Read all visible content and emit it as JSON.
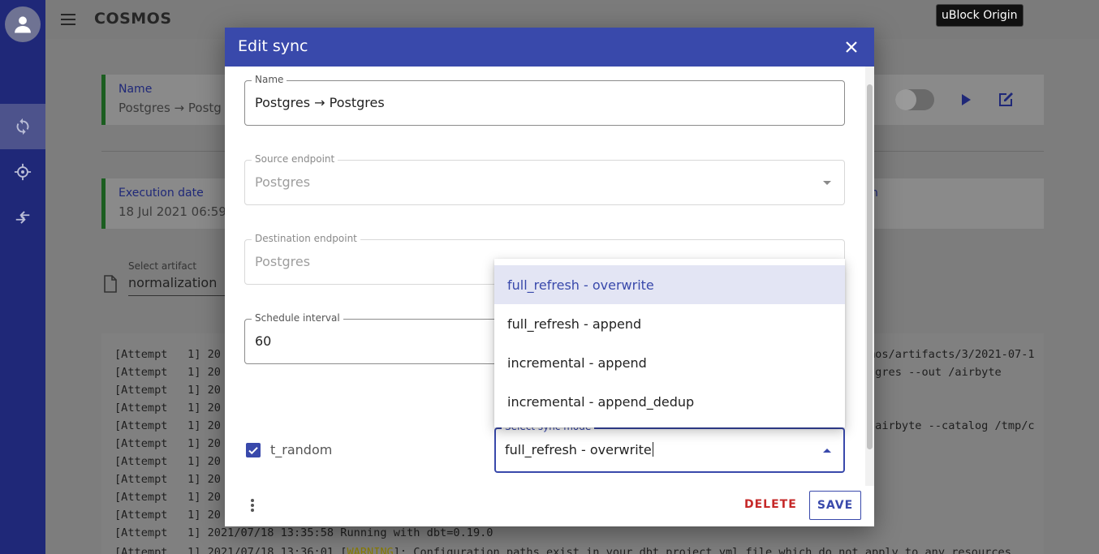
{
  "app": {
    "name": "COSMOS"
  },
  "tooltip": {
    "text": "uBlock Origin"
  },
  "background": {
    "name_card": {
      "label": "Name",
      "value": "Postgres → Postg"
    },
    "execution_card": {
      "label": "Execution date",
      "value": "18 Jul 2021 06:59"
    },
    "right_card_label": "n",
    "artifact": {
      "label": "Select artifact",
      "value": "normalization"
    },
    "log": {
      "lines": [
        {
          "prefix": "[Attempt   1] 20",
          "suffix": "mos/artifacts/3/2021-07-1"
        },
        {
          "prefix": "[Attempt   1] 20",
          "suffix": "tgres --out /airbyte"
        },
        {
          "prefix": "[Attempt   1] 20",
          "suffix": ""
        },
        {
          "prefix": "[Attempt   1] 20",
          "suffix": ""
        },
        {
          "prefix": "[Attempt   1] 20",
          "suffix": "/airbyte --catalog /tmp/c"
        },
        {
          "prefix": "[Attempt   1] 20",
          "suffix": ""
        },
        {
          "prefix": "[Attempt   1] 20",
          "suffix": ""
        },
        {
          "prefix": "[Attempt   1] 20",
          "suffix": ""
        },
        {
          "prefix": "[Attempt   1] 20",
          "suffix": ""
        },
        {
          "prefix": "[Attempt   1] 20",
          "suffix": ""
        },
        {
          "prefix": "[Attempt   1] 2021/07/18 13:35:58 Running with dbt=0.19.0",
          "suffix": ""
        }
      ],
      "last_line": {
        "before": "[Attempt   1] 2021/07/18 13:36:01 [",
        "warn": "WARNING",
        "after": "]: Configuration paths exist in your dbt_project.yml file which do not apply to any resources"
      }
    }
  },
  "dialog": {
    "title": "Edit sync",
    "fields": {
      "name": {
        "label": "Name",
        "value": "Postgres → Postgres"
      },
      "source": {
        "label": "Source endpoint",
        "value": "Postgres"
      },
      "destination": {
        "label": "Destination endpoint",
        "value": "Postgres"
      },
      "schedule": {
        "label": "Schedule interval",
        "value": "60"
      },
      "sync_mode": {
        "label": "Select sync mode",
        "value": "full_refresh - overwrite"
      }
    },
    "stream": {
      "name": "t_random",
      "checked": true
    },
    "dropdown_options": [
      {
        "label": "full_refresh - overwrite",
        "selected": true
      },
      {
        "label": "full_refresh - append",
        "selected": false
      },
      {
        "label": "incremental - append",
        "selected": false
      },
      {
        "label": "incremental - append_dedup",
        "selected": false
      }
    ],
    "buttons": {
      "delete": "DELETE",
      "save": "SAVE"
    }
  },
  "colors": {
    "sidebar": "#1f2878",
    "primary": "#3949ab",
    "delete": "#c62828",
    "success_border": "#1b5e20"
  }
}
